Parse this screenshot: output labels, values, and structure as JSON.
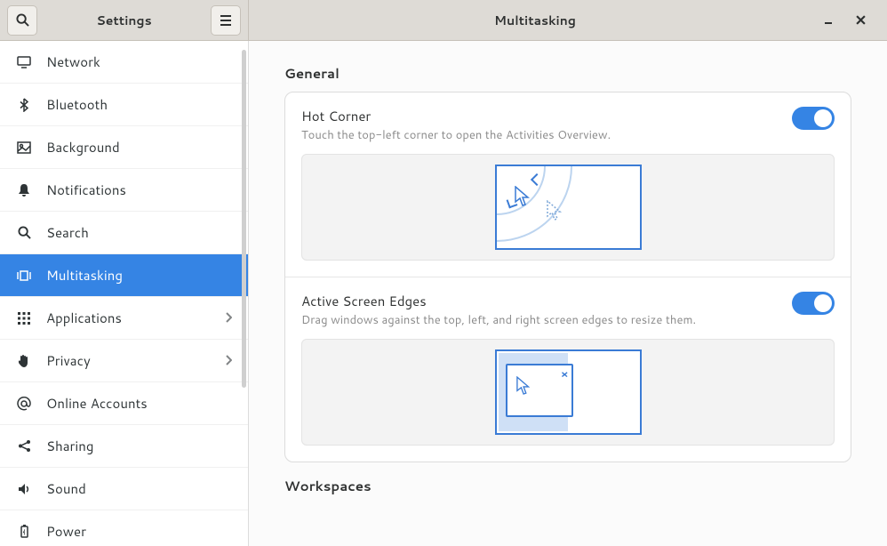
{
  "titlebar": {
    "left_title": "Settings",
    "right_title": "Multitasking"
  },
  "sidebar": {
    "items": [
      {
        "id": "network",
        "label": "Network",
        "icon": "screen",
        "chev": false
      },
      {
        "id": "bluetooth",
        "label": "Bluetooth",
        "icon": "bluetooth",
        "chev": false
      },
      {
        "id": "background",
        "label": "Background",
        "icon": "picture",
        "chev": false
      },
      {
        "id": "notifications",
        "label": "Notifications",
        "icon": "bell",
        "chev": false
      },
      {
        "id": "search",
        "label": "Search",
        "icon": "search",
        "chev": false
      },
      {
        "id": "multitasking",
        "label": "Multitasking",
        "icon": "workspaces",
        "chev": false,
        "selected": true
      },
      {
        "id": "applications",
        "label": "Applications",
        "icon": "grid",
        "chev": true
      },
      {
        "id": "privacy",
        "label": "Privacy",
        "icon": "hand",
        "chev": true
      },
      {
        "id": "online-accounts",
        "label": "Online Accounts",
        "icon": "at",
        "chev": false
      },
      {
        "id": "sharing",
        "label": "Sharing",
        "icon": "share",
        "chev": false
      },
      {
        "id": "sound",
        "label": "Sound",
        "icon": "speaker",
        "chev": false
      },
      {
        "id": "power",
        "label": "Power",
        "icon": "battery",
        "chev": false
      }
    ]
  },
  "content": {
    "sections": {
      "general": {
        "title": "General",
        "rows": {
          "hot_corner": {
            "title": "Hot Corner",
            "desc": "Touch the top-left corner to open the Activities Overview.",
            "enabled": true
          },
          "active_edges": {
            "title": "Active Screen Edges",
            "desc": "Drag windows against the top, left, and right screen edges to resize them.",
            "enabled": true
          }
        }
      },
      "workspaces": {
        "title": "Workspaces"
      }
    }
  }
}
